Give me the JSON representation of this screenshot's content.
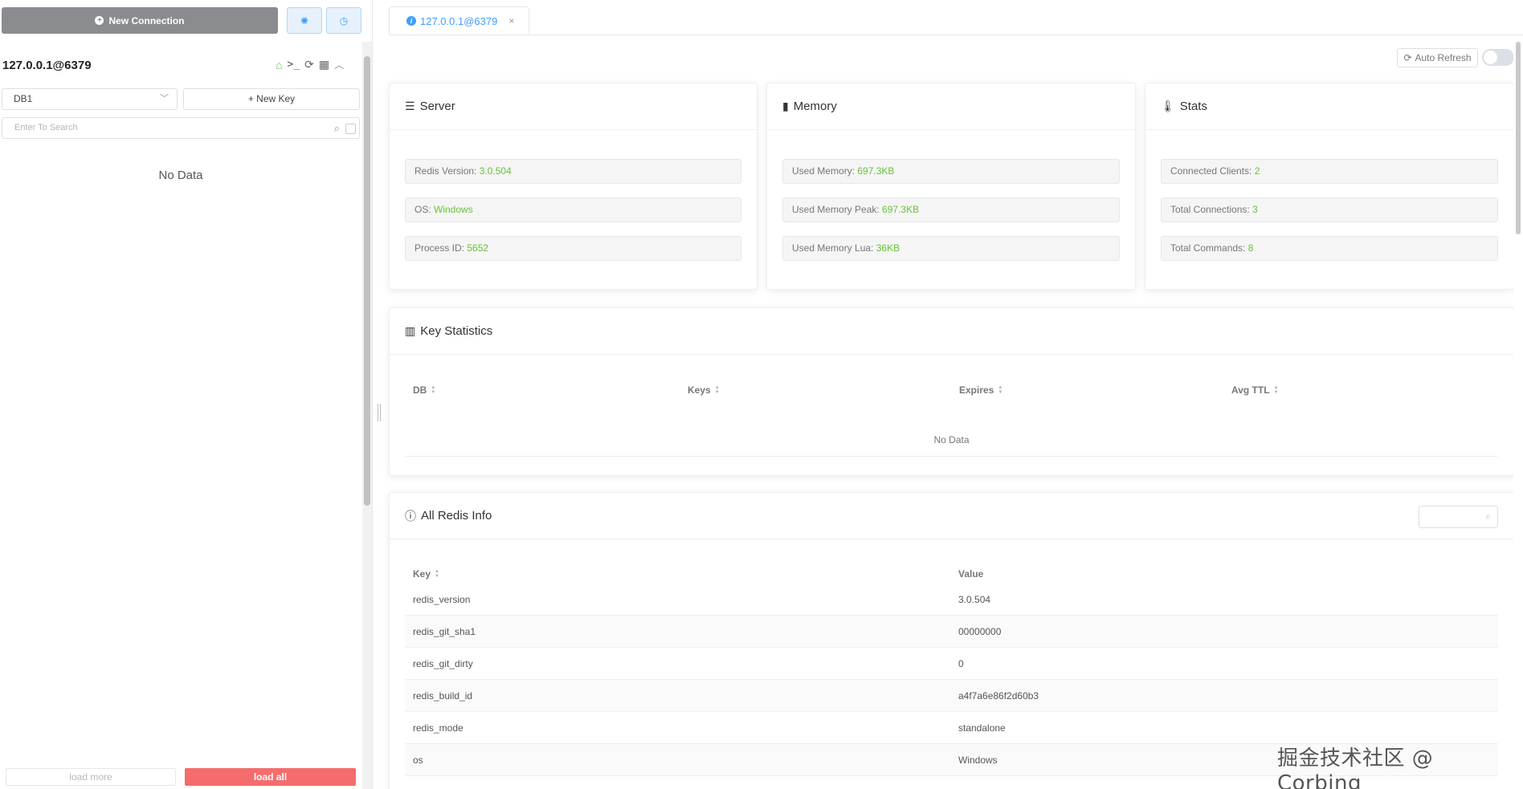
{
  "sidebar": {
    "new_connection_label": "New Connection",
    "connection_name": "127.0.0.1@6379",
    "db_selected": "DB1",
    "new_key_label": "+ New Key",
    "search_placeholder": "Enter To Search",
    "empty_text": "No Data",
    "load_more_label": "load more",
    "load_all_label": "load all"
  },
  "tabs": [
    {
      "label": "127.0.0.1@6379",
      "close": "×"
    }
  ],
  "toolbar": {
    "auto_refresh_label": "Auto Refresh",
    "auto_refresh_on": false
  },
  "server": {
    "title": "Server",
    "rows": [
      {
        "label": "Redis Version: ",
        "value": "3.0.504"
      },
      {
        "label": "OS: ",
        "value": "Windows"
      },
      {
        "label": "Process ID: ",
        "value": "5652"
      }
    ]
  },
  "memory": {
    "title": "Memory",
    "rows": [
      {
        "label": "Used Memory: ",
        "value": "697.3KB"
      },
      {
        "label": "Used Memory Peak: ",
        "value": "697.3KB"
      },
      {
        "label": "Used Memory Lua: ",
        "value": "36KB"
      }
    ]
  },
  "stats": {
    "title": "Stats",
    "rows": [
      {
        "label": "Connected Clients: ",
        "value": "2"
      },
      {
        "label": "Total Connections: ",
        "value": "3"
      },
      {
        "label": "Total Commands: ",
        "value": "8"
      }
    ]
  },
  "key_statistics": {
    "title": "Key Statistics",
    "columns": [
      "DB",
      "Keys",
      "Expires",
      "Avg TTL"
    ],
    "empty_text": "No Data"
  },
  "all_redis_info": {
    "title": "All Redis Info",
    "columns": [
      "Key",
      "Value"
    ],
    "rows": [
      {
        "key": "redis_version",
        "value": "3.0.504"
      },
      {
        "key": "redis_git_sha1",
        "value": "00000000"
      },
      {
        "key": "redis_git_dirty",
        "value": "0"
      },
      {
        "key": "redis_build_id",
        "value": "a4f7a6e86f2d60b3"
      },
      {
        "key": "redis_mode",
        "value": "standalone"
      },
      {
        "key": "os",
        "value": "Windows"
      }
    ]
  },
  "watermark": "掘金技术社区 @ Corbing",
  "colors": {
    "accent": "#409eff",
    "value_green": "#67c23a",
    "danger": "#f56c6c",
    "new_conn_bg": "#8a8c90"
  }
}
